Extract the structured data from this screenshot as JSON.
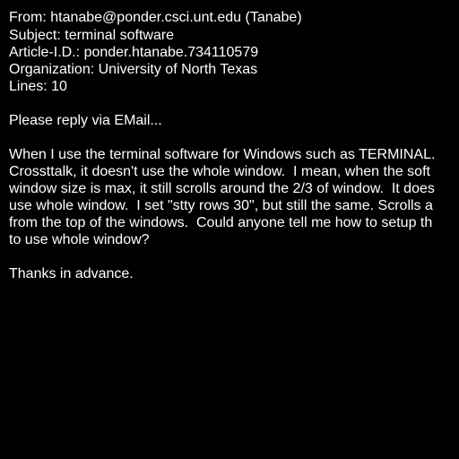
{
  "headers": {
    "from": "From: htanabe@ponder.csci.unt.edu (Tanabe)",
    "subject": "Subject: terminal software",
    "article_id": "Article-I.D.: ponder.htanabe.734110579",
    "organization": "Organization: University of North Texas",
    "lines": "Lines: 10"
  },
  "body": {
    "greeting": "Please reply via EMail...",
    "paragraph_lines": [
      "When I use the terminal software for Windows such as TERMINAL.",
      "Crossttalk, it doesn't use the whole window.  I mean, when the soft",
      "window size is max, it still scrolls around the 2/3 of window.  It does",
      "use whole window.  I set \"stty rows 30\", but still the same. Scrolls a",
      "from the top of the windows.  Could anyone tell me how to setup th",
      "to use whole window?"
    ],
    "closing": "Thanks in advance."
  }
}
